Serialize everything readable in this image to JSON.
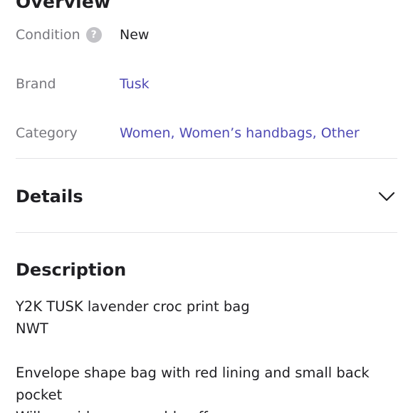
{
  "overview": {
    "heading": "Overview"
  },
  "rows": {
    "condition": {
      "label": "Condition",
      "value": "New"
    },
    "brand": {
      "label": "Brand",
      "value": "Tusk"
    },
    "category": {
      "label": "Category",
      "values": [
        "Women",
        "Women’s handbags",
        "Other"
      ],
      "separator": ", "
    }
  },
  "details": {
    "title": "Details"
  },
  "description": {
    "title": "Description",
    "lines": [
      "Y2K TUSK lavender croc print bag",
      "NWT",
      "",
      "Envelope shape bag with red lining and small back",
      "pocket",
      "Will consider reasonable offers"
    ]
  },
  "colors": {
    "link": "#4f4ab4",
    "label": "#77777d",
    "text": "#1f1f23",
    "divider": "#e3e3e6",
    "help_icon_bg": "#c3c3c7"
  },
  "icons": {
    "condition_help": "question-circle-icon",
    "details_toggle": "chevron-down-icon"
  }
}
